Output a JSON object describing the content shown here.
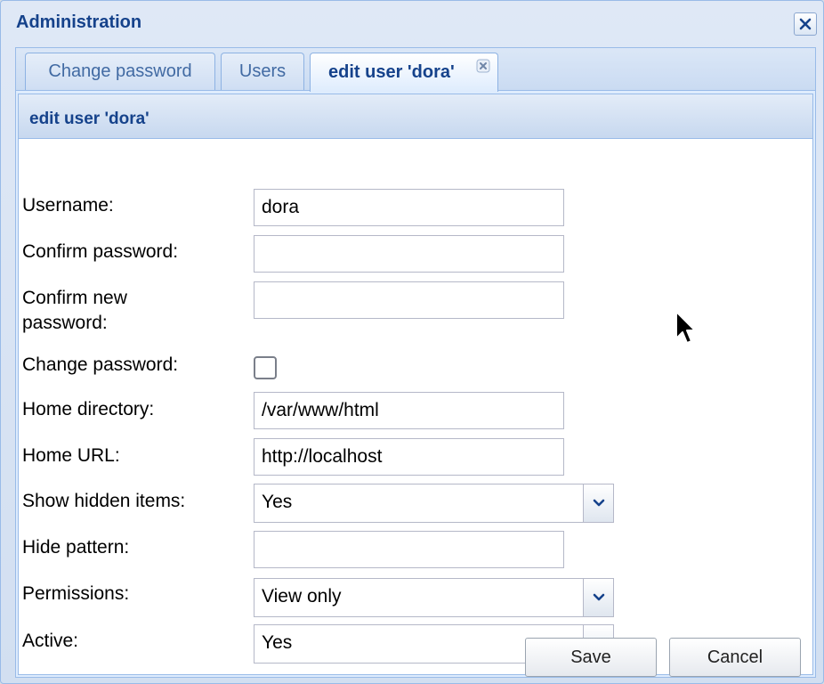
{
  "window": {
    "title": "Administration"
  },
  "tabs": [
    {
      "label": "Change password"
    },
    {
      "label": "Users"
    },
    {
      "label": "edit user 'dora'"
    }
  ],
  "panel": {
    "title": "edit user 'dora'"
  },
  "form": {
    "username": {
      "label": "Username:",
      "value": "dora"
    },
    "confirm_password": {
      "label": "Confirm password:",
      "value": ""
    },
    "confirm_new_password": {
      "label": "Confirm new password:",
      "value": ""
    },
    "change_password": {
      "label": "Change password:",
      "checked": false
    },
    "home_directory": {
      "label": "Home directory:",
      "value": "/var/www/html"
    },
    "home_url": {
      "label": "Home URL:",
      "value": "http://localhost"
    },
    "show_hidden": {
      "label": "Show hidden items:",
      "value": "Yes"
    },
    "hide_pattern": {
      "label": "Hide pattern:",
      "value": ""
    },
    "permissions": {
      "label": "Permissions:",
      "value": "View only"
    },
    "active": {
      "label": "Active:",
      "value": "Yes"
    }
  },
  "buttons": {
    "save": "Save",
    "cancel": "Cancel"
  },
  "icons": {
    "close": "close-icon",
    "tab_close": "tab-close-icon",
    "dropdown": "chevron-down-icon",
    "cursor": "mouse-pointer-icon"
  },
  "colors": {
    "title": "#15428b",
    "border": "#99bbe8",
    "tab_text": "#416aa3"
  }
}
